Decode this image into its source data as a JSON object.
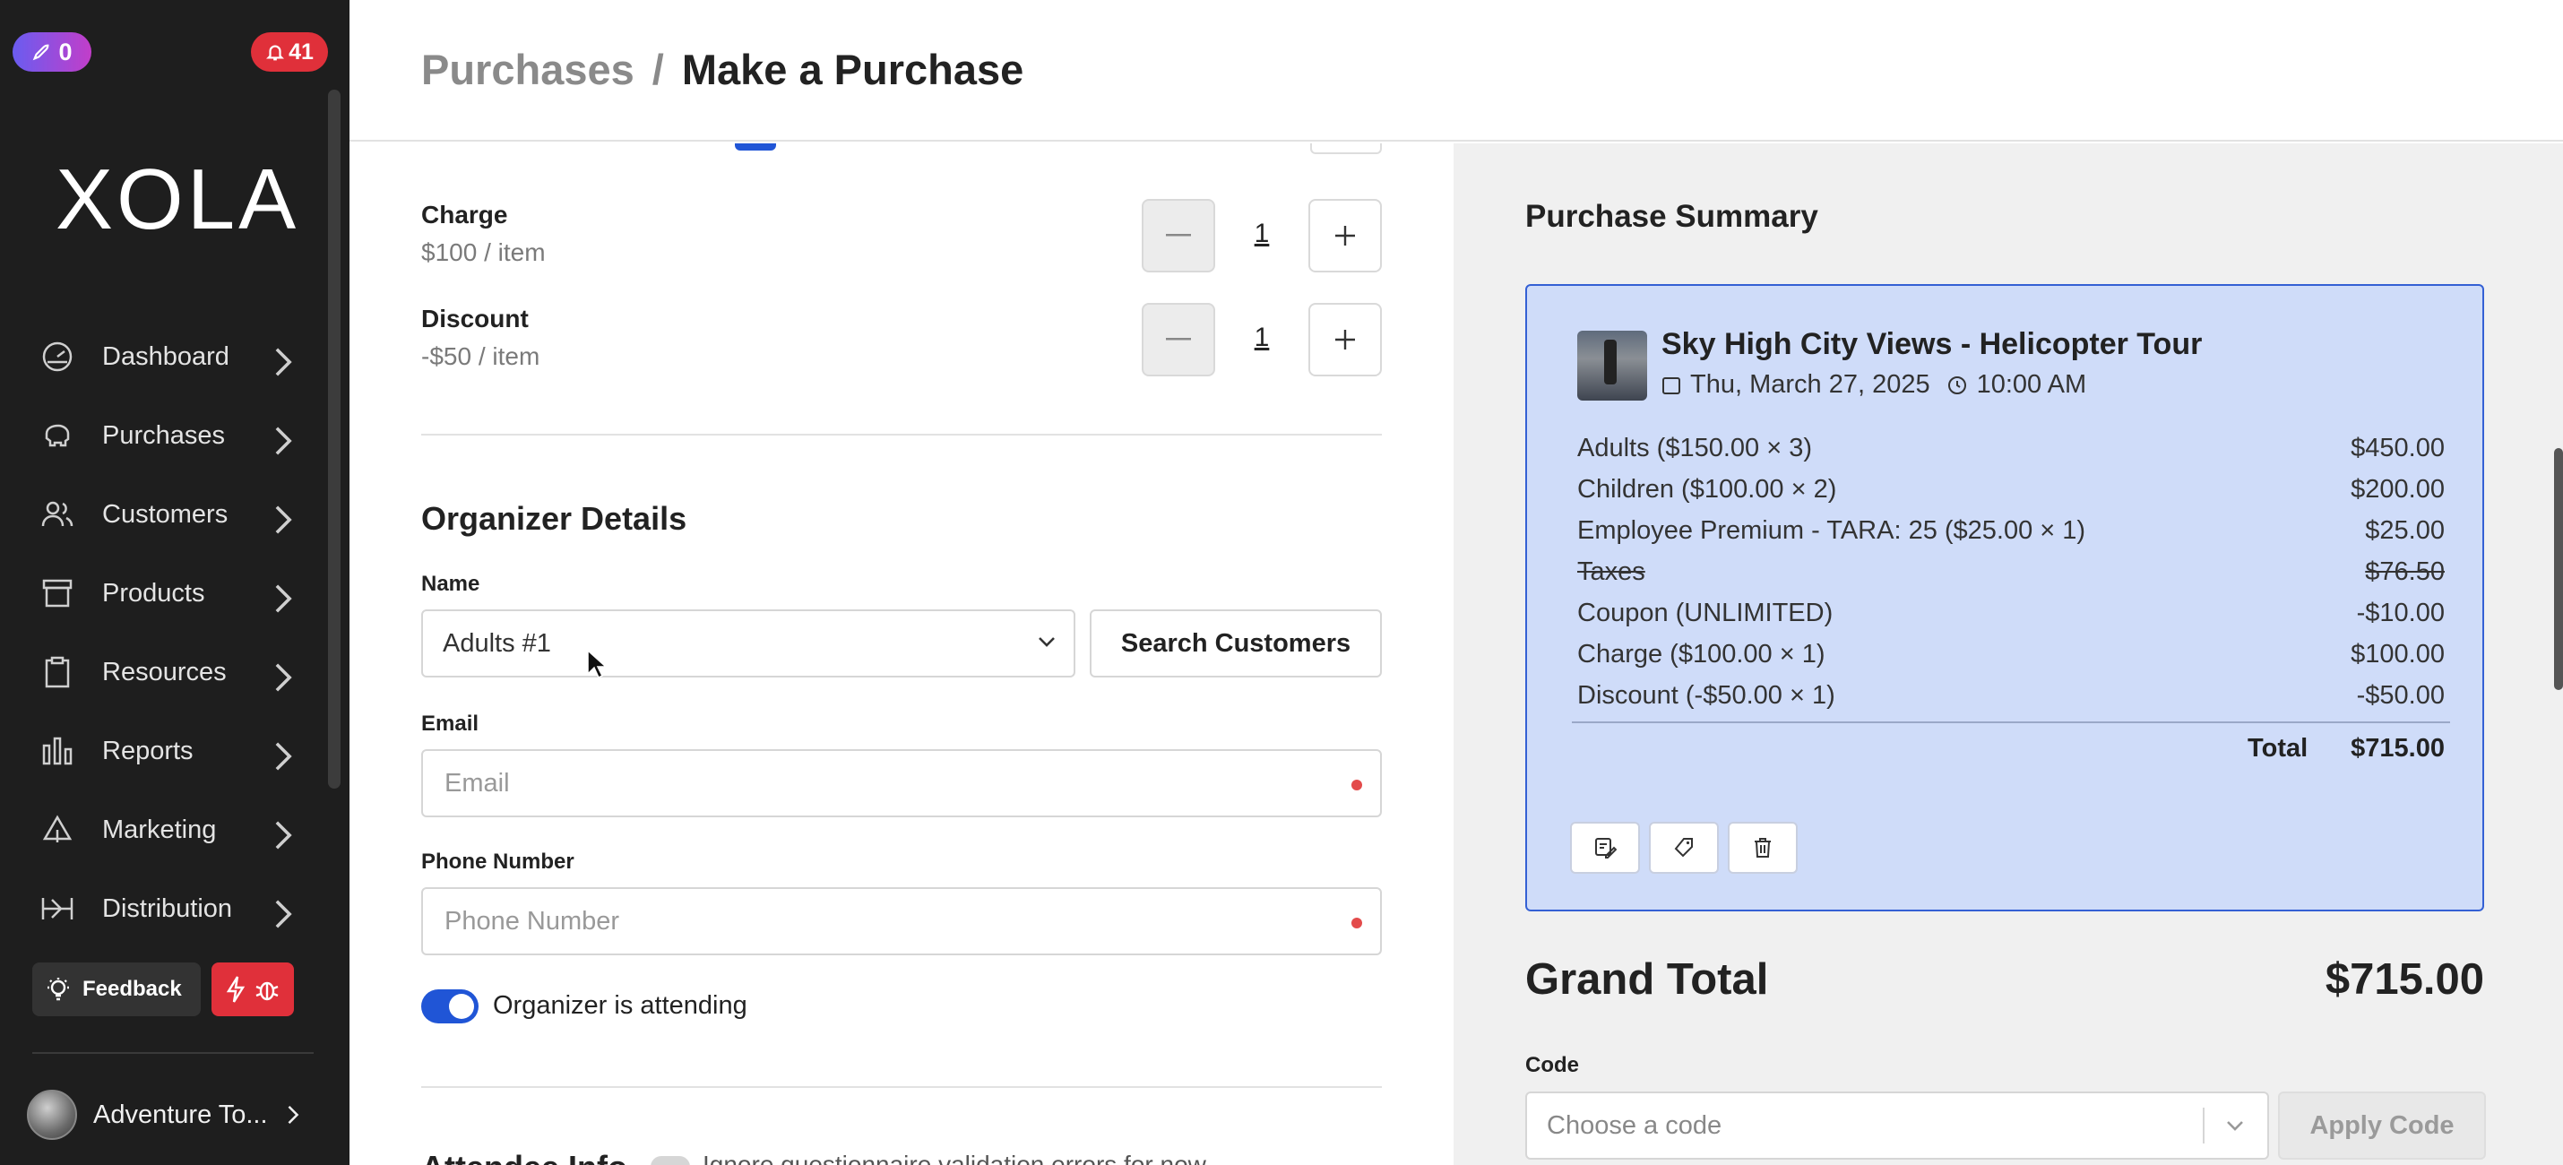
{
  "badges": {
    "reward_count": "0",
    "notification_count": "41"
  },
  "sidebar": {
    "logo": "XOLA",
    "items": [
      {
        "label": "Dashboard",
        "icon": "dashboard-icon"
      },
      {
        "label": "Purchases",
        "icon": "piggy-bank-icon"
      },
      {
        "label": "Customers",
        "icon": "users-icon"
      },
      {
        "label": "Products",
        "icon": "archive-icon"
      },
      {
        "label": "Resources",
        "icon": "clipboard-icon"
      },
      {
        "label": "Reports",
        "icon": "bar-chart-icon"
      },
      {
        "label": "Marketing",
        "icon": "megaphone-icon"
      },
      {
        "label": "Distribution",
        "icon": "distribution-icon"
      }
    ],
    "feedback_label": "Feedback",
    "account_name": "Adventure To..."
  },
  "header": {
    "breadcrumb_parent": "Purchases",
    "breadcrumb_sep": "/",
    "breadcrumb_current": "Make a Purchase"
  },
  "form": {
    "items": [
      {
        "label": "Charge",
        "price": "$100 / item",
        "qty": "1"
      },
      {
        "label": "Discount",
        "price": "-$50 / item",
        "qty": "1"
      }
    ],
    "organizer_title": "Organizer Details",
    "name_label": "Name",
    "name_value": "Adults #1",
    "search_customers": "Search Customers",
    "email_label": "Email",
    "email_placeholder": "Email",
    "phone_label": "Phone Number",
    "phone_placeholder": "Phone Number",
    "organizer_attending": "Organizer is attending",
    "attendee_title": "Attendee Info",
    "attendee_note": "Ignore questionnaire validation errors for now"
  },
  "summary": {
    "title": "Purchase Summary",
    "tour_title": "Sky High City Views - Helicopter Tour",
    "date": "Thu, March 27, 2025",
    "time": "10:00 AM",
    "lines": [
      {
        "label": "Adults ($150.00 × 3)",
        "amount": "$450.00"
      },
      {
        "label": "Children ($100.00 × 2)",
        "amount": "$200.00"
      },
      {
        "label": "Employee Premium - TARA: 25 ($25.00 × 1)",
        "amount": "$25.00"
      },
      {
        "label": "Taxes",
        "amount": "$76.50"
      },
      {
        "label": "Coupon (UNLIMITED)",
        "amount": "-$10.00"
      },
      {
        "label": "Charge ($100.00 × 1)",
        "amount": "$100.00"
      },
      {
        "label": "Discount (-$50.00 × 1)",
        "amount": "-$50.00"
      }
    ],
    "total_label": "Total",
    "total_value": "$715.00",
    "grand_total_label": "Grand Total",
    "grand_total_value": "$715.00",
    "code_label": "Code",
    "code_placeholder": "Choose a code",
    "apply_code": "Apply Code"
  },
  "colors": {
    "accent": "#2055d6",
    "sidebar_bg": "#1e1e1e",
    "summary_card_bg": "#cfdcf9",
    "danger": "#e0303a"
  }
}
